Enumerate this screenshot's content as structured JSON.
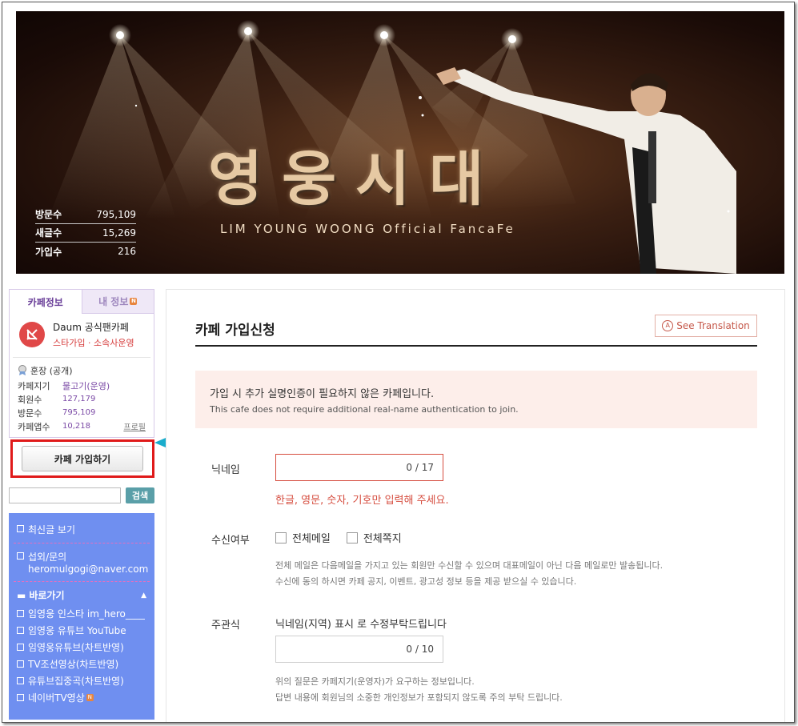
{
  "banner": {
    "title": "영웅시대",
    "subtitle": "LIM YOUNG WOONG Official FancaFe",
    "stats": [
      {
        "label": "방문수",
        "value": "795,109"
      },
      {
        "label": "새글수",
        "value": "15,269"
      },
      {
        "label": "가입수",
        "value": "216"
      }
    ]
  },
  "sidebar": {
    "tabs": {
      "cafe_info": "카페정보",
      "my_info": "내 정보",
      "badge": "N"
    },
    "cafe_type": {
      "name": "Daum 공식팬카페",
      "desc": "스타가입 · 소속사운영"
    },
    "rank": "훈장 (공개)",
    "rows": [
      {
        "label": "카페지기",
        "value": "물고기(운영)"
      },
      {
        "label": "회원수",
        "value": "127,179"
      },
      {
        "label": "방문수",
        "value": "795,109"
      },
      {
        "label": "카페앱수",
        "value": "10,218"
      }
    ],
    "profile_link": "프로필",
    "join_button": "카페 가입하기",
    "search_button": "검색",
    "menu": {
      "recent": "최신글 보기",
      "contact": "섭외/문의",
      "contact_email": "heromulgogi@naver.com",
      "shortcut_title": "바로가기",
      "shortcuts": [
        "임영웅 인스타 im_hero____",
        "임영웅 유튜브 YouTube",
        "임영웅유튜브(차트반영)",
        "TV조선영상(차트반영)",
        "유튜브집중곡(차트반영)",
        "네이버TV영상"
      ],
      "shortcut_badge": "N"
    }
  },
  "main": {
    "title": "카페 가입신청",
    "translate_button": "See Translation",
    "notice_ko": "가입 시 추가 실명인증이 필요하지 않은 카페입니다.",
    "notice_en": "This cafe does not require additional real-name authentication to join.",
    "nickname_label": "닉네임",
    "nickname_counter": "0 / 17",
    "nickname_error": "한글, 영문, 숫자, 기호만 입력해 주세요.",
    "receive_label": "수신여부",
    "receive_all_mail": "전체메일",
    "receive_all_note": "전체쪽지",
    "receive_desc_1": "전체 메일은 다음메일을 가지고 있는 회원만 수신할 수 있으며 대표메일이 아닌 다음 메일로만 발송됩니다.",
    "receive_desc_2": "수신에 동의 하시면 카페 공지, 이벤트, 광고성 정보 등을 제공 받으실 수 있습니다.",
    "question_label": "주관식",
    "question_text": "닉네임(지역) 표시 로 수정부탁드립니다",
    "answer_counter": "0 / 10",
    "question_desc_1": "위의 질문은 카페지기(운영자)가 요구하는 정보입니다.",
    "question_desc_2": "답변 내용에 회원님의 소중한 개인정보가 포함되지 않도록 주의 부탁 드립니다."
  },
  "colors": {
    "accent_red": "#d64d3f",
    "highlight_border": "#e01a1a",
    "menu_bg": "#6f8ff0",
    "pointer_arrow": "#1aaccc"
  }
}
